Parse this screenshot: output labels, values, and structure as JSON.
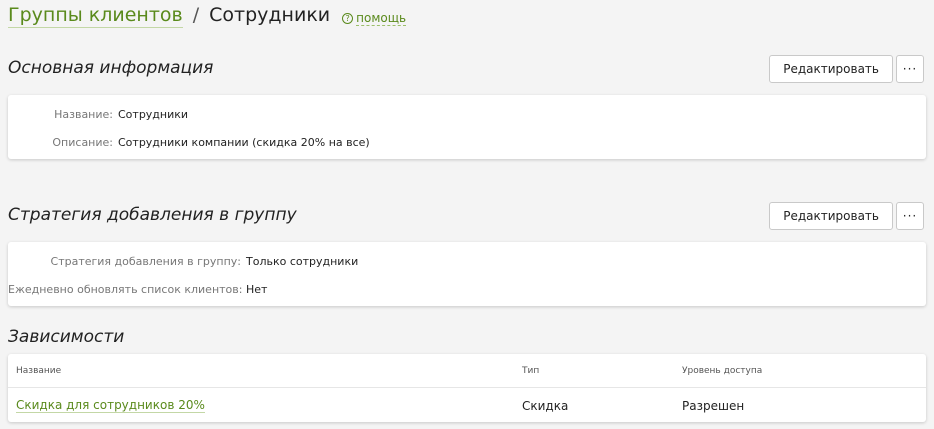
{
  "header": {
    "breadcrumb_link": "Группы клиентов",
    "separator": "/",
    "title": "Сотрудники",
    "help_icon": "question-circle-icon",
    "help_label": "помощь"
  },
  "basic_info": {
    "title": "Основная информация",
    "edit_label": "Редактировать",
    "more_label": "···",
    "fields": [
      {
        "label": "Название:",
        "value": "Сотрудники"
      },
      {
        "label": "Описание:",
        "value": "Сотрудники компании (скидка 20% на все)"
      }
    ]
  },
  "strategy": {
    "title": "Стратегия добавления в группу",
    "edit_label": "Редактировать",
    "more_label": "···",
    "fields": [
      {
        "label": "Стратегия добавления в группу:",
        "value": "Только сотрудники"
      },
      {
        "label": "Ежедневно обновлять список клиентов:",
        "value": "Нет"
      }
    ]
  },
  "dependencies": {
    "title": "Зависимости",
    "columns": [
      "Название",
      "Тип",
      "Уровень доступа"
    ],
    "rows": [
      {
        "name": "Скидка для сотрудников 20%",
        "type": "Скидка",
        "access": "Разрешен"
      }
    ]
  },
  "colors": {
    "link": "#5a8a1c",
    "background": "#f4f4f4",
    "card": "#ffffff"
  }
}
